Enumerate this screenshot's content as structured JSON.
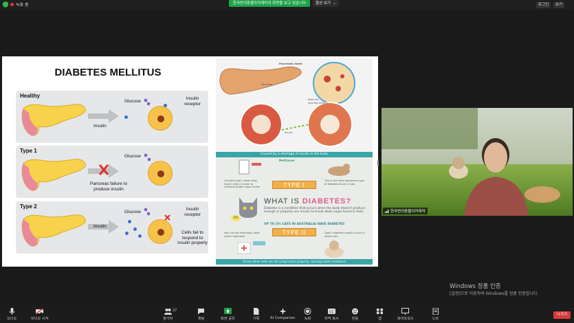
{
  "topbar": {
    "recording_label": "녹화 중",
    "share_banner": "한국반려동물아카데미의 화면을 보고 있습니다",
    "view_options": "옵션 보기",
    "login_label": "로그인",
    "view_label": "보기"
  },
  "slide_left": {
    "title": "DIABETES MELLITUS",
    "rows": [
      {
        "label": "Healthy",
        "glucose": "Glucose",
        "insulin": "Insulin",
        "receptor": "Insulin receptor"
      },
      {
        "label": "Type 1",
        "glucose": "Glucose",
        "failure": "Pancreas failure to produce insulin"
      },
      {
        "label": "Type 2",
        "glucose": "Glucose",
        "insulin": "Insulin",
        "receptor": "Insulin receptor",
        "fail": "Cells fail to respond to insulin properly"
      }
    ]
  },
  "slide_right": {
    "top_labels": [
      "Pancreatic islets",
      "Pancreas",
      "Beta cell (secrete insulin)",
      "Insulin"
    ],
    "bar1": "Caused by a shortage of insulin in the body",
    "brand": "PetCover",
    "type1": "TYPE I",
    "type1_left": "Cat with type I needs daily insulin shots in order to maintain proper sugar levels",
    "type1_right": "This is the most dangerous type of diabetes found in cats",
    "what_prefix": "WHAT IS",
    "what_highlight": "DIABETES?",
    "definition": "Diabetes is a condition that occurs when the body doesn't produce enough or properly use insulin to break down sugar found in food.",
    "percent_badge": "2%",
    "stat": "UP TO 2% CATS IN AUSTRALIA HAVE DIABETES",
    "type2": "TYPE II",
    "type2_left": "Your cat will eventually need insulin injections",
    "type2_right": "Type II diabetes mostly occurs in obese cats",
    "bar2": "Occurs when cells are not using insulin properly, causing insulin resistance"
  },
  "video": {
    "participant_name": "한국반려동물아카데미"
  },
  "watermark": {
    "line1": "Windows 정품 인증",
    "line2": "[설정]으로 이동하여 Windows를 정품 인증합니다."
  },
  "toolbar": {
    "mic": "오디오",
    "video": "비디오 시작",
    "participants": "참가자",
    "participants_count": "27",
    "chat": "채팅",
    "share": "화면 공유",
    "record": "기록",
    "ai": "AI Companion",
    "record2": "녹화",
    "captions": "자막 표시",
    "reactions": "반응",
    "apps": "앱",
    "whiteboard": "화이트보드",
    "notes": "노트",
    "leave": "나가기"
  },
  "colors": {
    "share_green": "#1fa34a",
    "leave_red": "#d63b3b",
    "teal": "#3aa5a6",
    "orange": "#f2b04a"
  }
}
